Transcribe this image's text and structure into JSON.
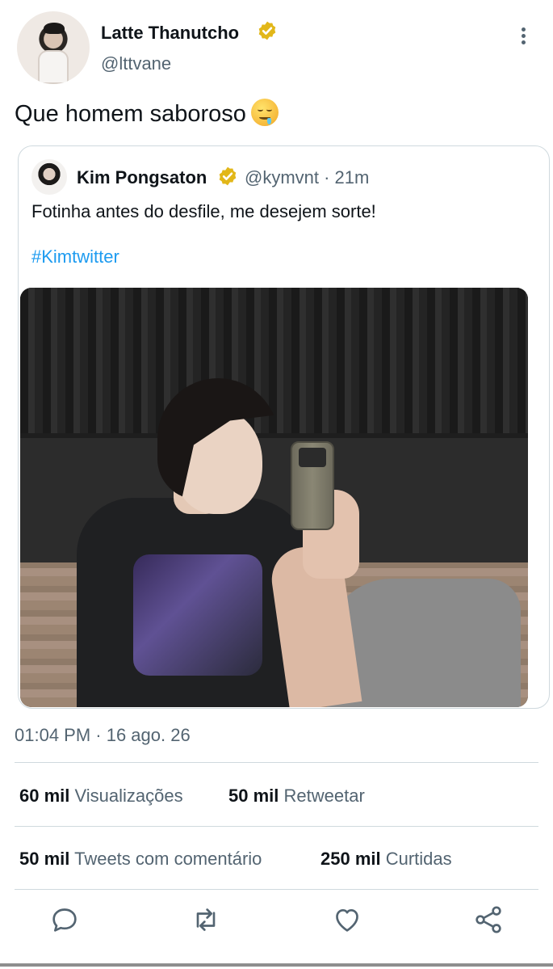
{
  "author": {
    "display_name": "Latte Thanutcho",
    "handle": "@lttvane"
  },
  "tweet": {
    "text": "Que homem saboroso",
    "emoji_name": "drooling-face-emoji"
  },
  "quoted": {
    "display_name": "Kim Pongsaton",
    "handle_time": "@kymvnt · 21m",
    "text": "Fotinha antes do desfile, me desejem sorte!",
    "hashtag": "#Kimtwitter"
  },
  "timestamp": "01:04 PM · 16 ago. 26",
  "stats": {
    "views_count": "60 mil",
    "views_label": "Visualizações",
    "retweets_count": "50 mil",
    "retweets_label": "Retweetar",
    "quotes_count": "50 mil",
    "quotes_label": "Tweets com comentário",
    "likes_count": "250 mil",
    "likes_label": "Curtidas"
  },
  "icons": {
    "verified": "verified-badge-icon",
    "more": "more-options-icon",
    "reply": "reply-icon",
    "retweet": "retweet-icon",
    "like": "heart-icon",
    "share": "share-icon"
  },
  "colors": {
    "link": "#1d9bf0",
    "verified_gold": "#e2b719",
    "secondary_text": "#536471",
    "border": "#cfd9de"
  }
}
